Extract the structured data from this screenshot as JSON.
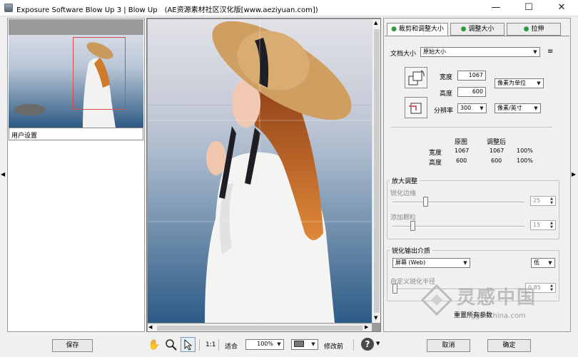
{
  "window": {
    "title": "Exposure Software Blow Up 3 | Blow Up　(AE资源素材社区汉化版[www.aeziyuan.com])",
    "minimize": "—",
    "maximize": "☐",
    "close": "✕"
  },
  "left": {
    "user_settings": "用户设置"
  },
  "tabs": [
    "裁剪和调整大小",
    "调整大小",
    "拉伸"
  ],
  "doc": {
    "label": "文档大小",
    "value": "原始大小"
  },
  "size": {
    "width_label": "宽度",
    "width_value": "1067",
    "height_label": "高度",
    "height_value": "600",
    "unit": "像素为单位",
    "res_label": "分辨率",
    "res_value": "300",
    "res_unit": "像素/英寸"
  },
  "info": {
    "col_orig": "原图",
    "col_adj": "调整后",
    "row_w": "宽度",
    "w_orig": "1067",
    "w_adj": "1067",
    "w_pct": "100%",
    "row_h": "高度",
    "h_orig": "600",
    "h_adj": "600",
    "h_pct": "100%"
  },
  "enlarge": {
    "title": "放大调整",
    "sharpen_label": "锐化边缘",
    "sharpen_value": "25",
    "sharpen_level": 0.25,
    "grain_label": "添加颗粒",
    "grain_value": "15",
    "grain_level": 0.15
  },
  "output": {
    "title": "锐化输出介质",
    "media": "屏幕 (Web)",
    "level": "低",
    "radius_label": "自定义锐化半径",
    "radius_value": "0.85"
  },
  "reset": "重置所有参数",
  "bottom": {
    "save": "保存",
    "ratio": "1:1",
    "fit": "适合",
    "zoom": "100%",
    "before": "修改前",
    "cancel": "取消",
    "ok": "确定"
  },
  "watermark": {
    "main": "灵感中国",
    "url": "lingganchina.com"
  },
  "colors": {
    "selection": "#d94a4a",
    "accent_green": "#2e9a3a"
  }
}
